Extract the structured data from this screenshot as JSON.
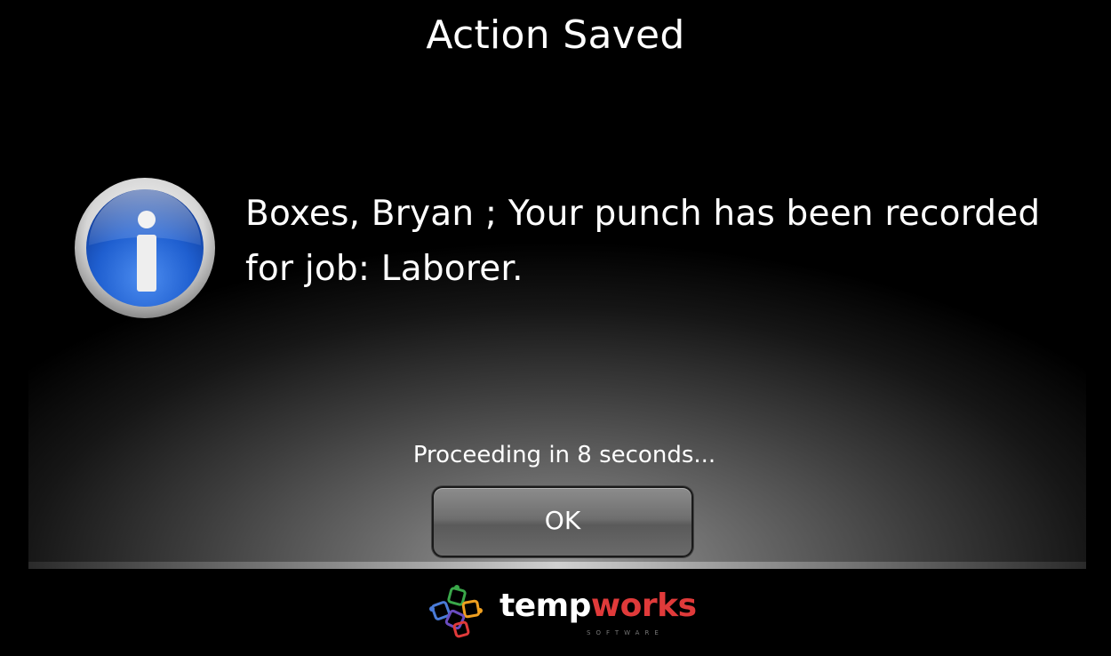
{
  "dialog": {
    "title": "Action Saved",
    "message": "Boxes, Bryan ; Your punch has been recorded for job: Laborer.",
    "countdown": "Proceeding in 8 seconds...",
    "ok_label": "OK",
    "icon": "info-icon"
  },
  "branding": {
    "logo_temp": "temp",
    "logo_works": "works",
    "logo_tagline": "SOFTWARE",
    "accent_color": "#e03a3a"
  }
}
